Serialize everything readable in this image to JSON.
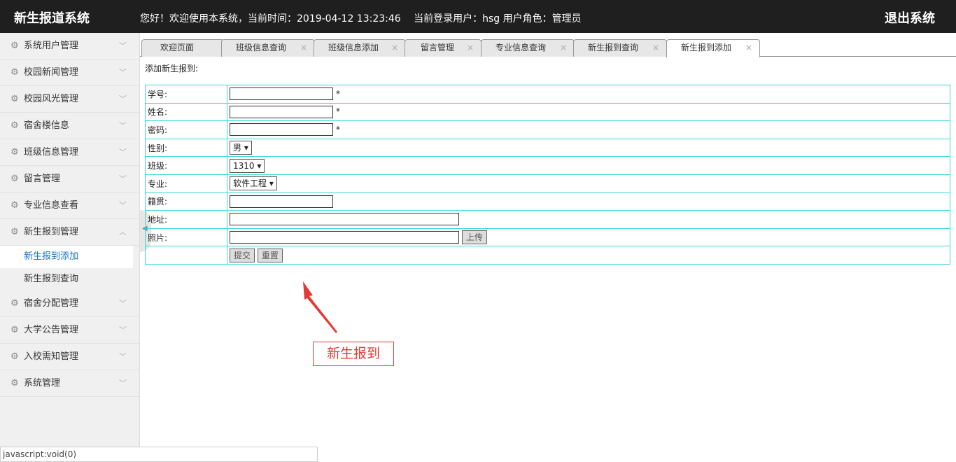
{
  "header": {
    "title": "新生报道系统",
    "welcome": "您好！欢迎使用本系统，当前时间：2019-04-12 13:23:46 　当前登录用户：hsg  用户角色：管理员",
    "logout_label": "退出系统"
  },
  "sidebar": {
    "items": [
      {
        "label": "系统用户管理"
      },
      {
        "label": "校园新闻管理"
      },
      {
        "label": "校园风光管理"
      },
      {
        "label": "宿舍楼信息"
      },
      {
        "label": "班级信息管理"
      },
      {
        "label": "留言管理"
      },
      {
        "label": "专业信息查看"
      },
      {
        "label": "新生报到管理"
      },
      {
        "label": "宿舍分配管理"
      },
      {
        "label": "大学公告管理"
      },
      {
        "label": "入校需知管理"
      },
      {
        "label": "系统管理"
      }
    ],
    "subitems": [
      {
        "label": "新生报到添加"
      },
      {
        "label": "新生报到查询"
      }
    ]
  },
  "tabs": [
    {
      "label": "欢迎页面"
    },
    {
      "label": "班级信息查询"
    },
    {
      "label": "班级信息添加"
    },
    {
      "label": "留言管理"
    },
    {
      "label": "专业信息查询"
    },
    {
      "label": "新生报到查询"
    },
    {
      "label": "新生报到添加"
    }
  ],
  "form": {
    "heading": "添加新生报到:",
    "student_no_label": "学号:",
    "name_label": "姓名:",
    "password_label": "密码:",
    "gender_label": "性别:",
    "gender_value": "男",
    "class_label": "班级:",
    "class_value": "1310",
    "major_label": "专业:",
    "major_value": "软件工程",
    "origin_label": "籍贯:",
    "address_label": "地址:",
    "photo_label": "照片:",
    "required_mark": "*",
    "upload_label": "上传",
    "submit_label": "提交",
    "reset_label": "重置"
  },
  "annotation": {
    "text": "新生报到"
  },
  "status": {
    "text": "javascript:void(0)"
  },
  "colors": {
    "accent": "#1a73c9",
    "table_border": "#3dd6d6",
    "annotation": "#e53935",
    "topbar": "#1f1f1f"
  }
}
